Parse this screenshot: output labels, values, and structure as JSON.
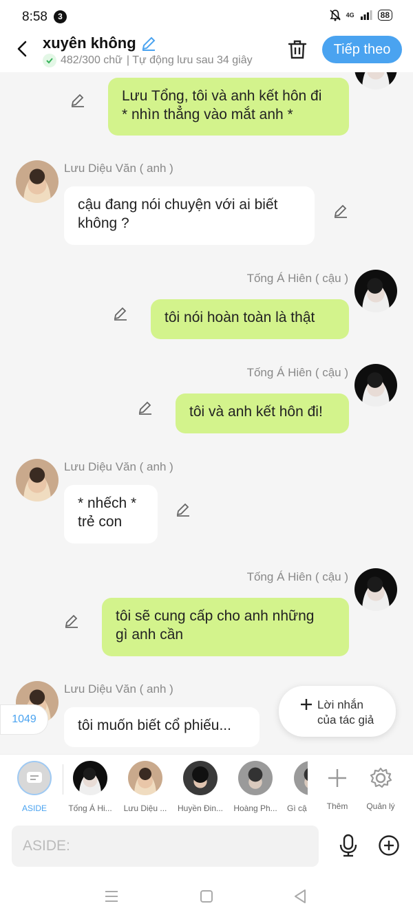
{
  "status_bar": {
    "time": "8:58",
    "notification_count": "3",
    "battery": "88",
    "network": "4G"
  },
  "header": {
    "title": "xuyên không",
    "word_count": "482/300 chữ",
    "autosave": "| Tự động lưu sau 34 giây",
    "next_label": "Tiếp theo"
  },
  "messages": [
    {
      "side": "right",
      "text_lines": [
        "Lưu Tổng, tôi và anh kết hôn đi",
        "* nhìn thẳng vào mắt anh *"
      ]
    },
    {
      "side": "left",
      "speaker": "Lưu Diệu Văn ( anh )",
      "text_lines": [
        "cậu đang nói chuyện với ai biết",
        "không ?"
      ]
    },
    {
      "side": "right",
      "speaker": "Tống Á Hiên ( cậu )",
      "text_lines": [
        "tôi nói hoàn toàn là thật"
      ]
    },
    {
      "side": "right",
      "speaker": "Tống Á Hiên ( cậu )",
      "text_lines": [
        "tôi và anh kết hôn đi!"
      ]
    },
    {
      "side": "left",
      "speaker": "Lưu Diệu Văn ( anh )",
      "text_lines": [
        "* nhếch *",
        "trẻ con"
      ]
    },
    {
      "side": "right",
      "speaker": "Tống Á Hiên ( cậu )",
      "text_lines": [
        "tôi sẽ cung cấp cho anh những",
        "gì anh cần"
      ]
    },
    {
      "side": "left",
      "speaker": "Lưu Diệu Văn ( anh )",
      "text_lines": [
        "tôi muốn biết cổ phiếu..."
      ]
    }
  ],
  "counter": "1049",
  "author_note": {
    "line1": "Lời nhắn",
    "line2": "của tác giả"
  },
  "characters": [
    {
      "label": "ASIDE"
    },
    {
      "label": "Tống Á Hi..."
    },
    {
      "label": "Lưu Diệu ..."
    },
    {
      "label": "Huyền Đin..."
    },
    {
      "label": "Hoàng Ph..."
    },
    {
      "label": "Gì cậ"
    }
  ],
  "actions": {
    "add_label": "Thêm",
    "manage_label": "Quản lý"
  },
  "input": {
    "placeholder": "ASIDE:"
  },
  "colors": {
    "accent": "#4aa3f0",
    "right_bubble": "#d3f38c",
    "background": "#f5f5f5"
  }
}
